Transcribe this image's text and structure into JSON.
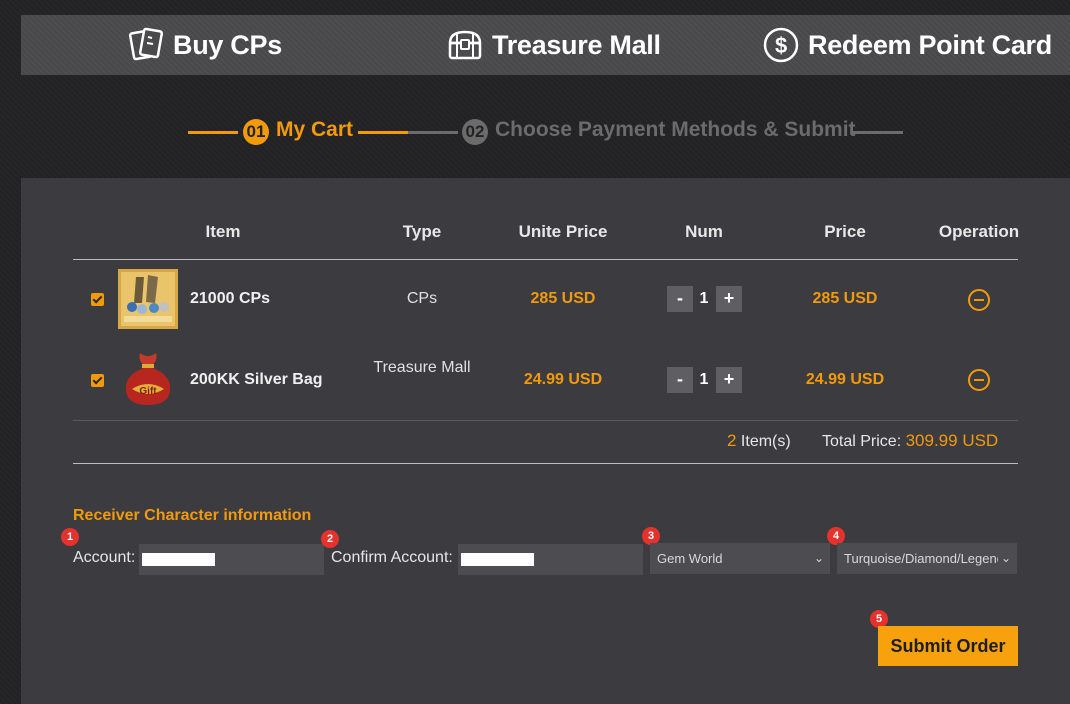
{
  "nav": {
    "items": [
      {
        "label": "Buy CPs",
        "icon": "cards-icon"
      },
      {
        "label": "Treasure Mall",
        "icon": "treasure-chest-icon"
      },
      {
        "label": "Redeem Point Card",
        "icon": "dollar-coin-icon"
      }
    ]
  },
  "steps": [
    {
      "num": "01",
      "label": "My Cart",
      "active": true
    },
    {
      "num": "02",
      "label": "Choose Payment Methods & Submit",
      "active": false
    }
  ],
  "table": {
    "headers": [
      "Item",
      "Type",
      "Unite Price",
      "Num",
      "Price",
      "Operation"
    ],
    "rows": [
      {
        "name": "21000 CPs",
        "type": "CPs",
        "unit_price": "285 USD",
        "qty": "1",
        "price": "285 USD",
        "checked": true
      },
      {
        "name": "200KK Silver Bag",
        "type": "Treasure Mall",
        "unit_price": "24.99 USD",
        "qty": "1",
        "price": "24.99 USD",
        "checked": true
      }
    ],
    "qty_minus": "-",
    "qty_plus": "+"
  },
  "summary": {
    "count": "2",
    "items_label": "Item(s)",
    "total_label": "Total Price:",
    "total_value": "309.99 USD"
  },
  "receiver": {
    "title": "Receiver Character information",
    "account_label": "Account:",
    "confirm_label": "Confirm Account:",
    "server_select": "Gem World",
    "group_select": "Turquoise/Diamond/Legend"
  },
  "markers": [
    "1",
    "2",
    "3",
    "4",
    "5"
  ],
  "submit_label": "Submit Order",
  "colors": {
    "accent": "#f29a0a",
    "marker": "#e5322d",
    "panel": "#3c3b3f"
  }
}
